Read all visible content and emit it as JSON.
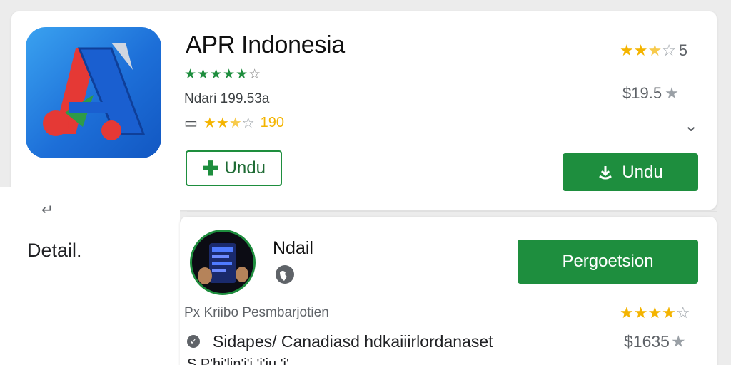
{
  "app": {
    "title": "APR Indonesia",
    "green_rating_stars": "★★★★★",
    "green_rating_empty": "☆",
    "developer_line": "Ndari 199.53a",
    "age_badge": "▭",
    "rating_stars": "★★",
    "rating_half": "★",
    "rating_empty": "☆",
    "rating_count": "190",
    "outline_button_label": "Undu",
    "filled_button_label": "Undu",
    "right_rating_stars": "★★",
    "right_rating_half": "★",
    "right_rating_empty": "☆",
    "right_rating_value": "5",
    "price": "$19.5",
    "expand_glyph": "⌄"
  },
  "sidebar": {
    "back_glyph": "↵",
    "detail_label": "Detail."
  },
  "second": {
    "title": "Ndail",
    "action_button_label": "Pergoetsion",
    "category_line": "Px Kriibo Pesmbarjotien",
    "description": "Sidapes/ Canadiasd hdkaiiirlordanaset",
    "next_line": "S P'hi'lin'i'i 'i'iu 'i'... ",
    "rating_stars": "★★★★",
    "rating_empty": "☆",
    "price": "$1635",
    "price_star": "★"
  },
  "colors": {
    "accent_green": "#1e8e3e",
    "star_gold": "#f4b400",
    "icon_blue": "#1d6fd8",
    "icon_red": "#e53935"
  }
}
